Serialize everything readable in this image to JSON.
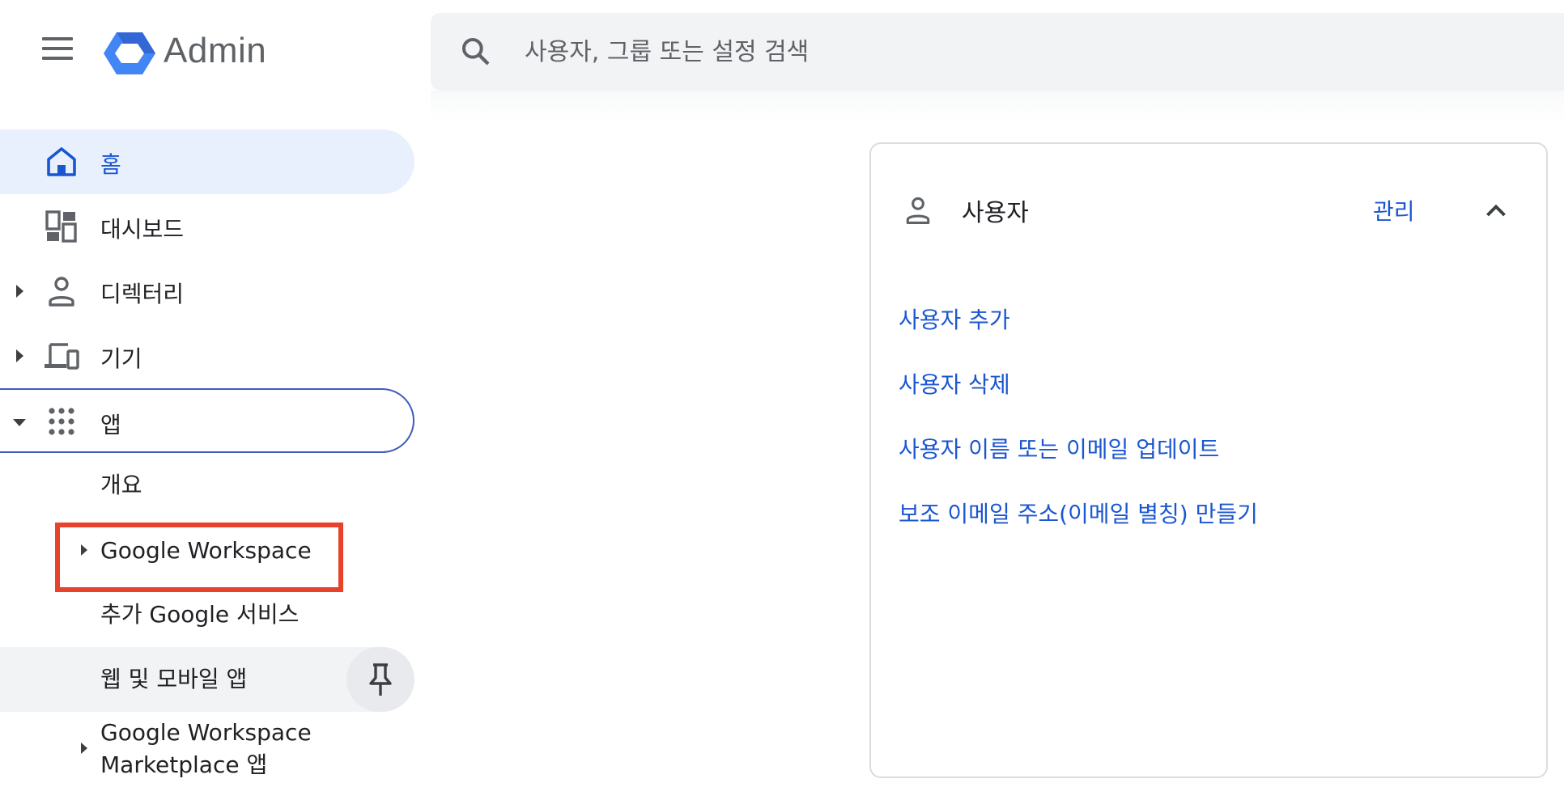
{
  "header": {
    "app_title": "Admin",
    "menu_icon": "hamburger-menu-icon",
    "logo_icon": "admin-hexagon-logo",
    "search": {
      "placeholder": "사용자, 그룹 또는 설정 검색",
      "value": ""
    }
  },
  "sidebar": {
    "items": [
      {
        "label": "홈",
        "icon": "home-icon",
        "state": "active"
      },
      {
        "label": "대시보드",
        "icon": "dashboard-icon"
      },
      {
        "label": "디렉터리",
        "icon": "person-icon",
        "expandable": "collapsed"
      },
      {
        "label": "기기",
        "icon": "devices-icon",
        "expandable": "collapsed"
      },
      {
        "label": "앱",
        "icon": "apps-grid-icon",
        "expandable": "expanded"
      }
    ],
    "apps_children": [
      {
        "label": "개요"
      },
      {
        "label": "Google Workspace",
        "expandable": "collapsed"
      },
      {
        "label": "추가 Google 서비스"
      },
      {
        "label": "웹 및 모바일 앱",
        "highlighted": true,
        "pin_icon": "pin-icon"
      },
      {
        "label_line1": "Google Workspace",
        "label_line2": "Marketplace 앱",
        "expandable": "collapsed"
      }
    ]
  },
  "users_card": {
    "icon": "person-icon",
    "title": "사용자",
    "manage_label": "관리",
    "collapse_icon": "chevron-up-icon",
    "links": [
      "사용자 추가",
      "사용자 삭제",
      "사용자 이름 또는 이메일 업데이트",
      "보조 이메일 주소(이메일 별칭) 만들기"
    ]
  },
  "colors": {
    "accent": "#1a56d0",
    "active_bg": "#e8f0fe",
    "highlight_border": "#e8412c",
    "search_bg": "#f1f3f4"
  }
}
